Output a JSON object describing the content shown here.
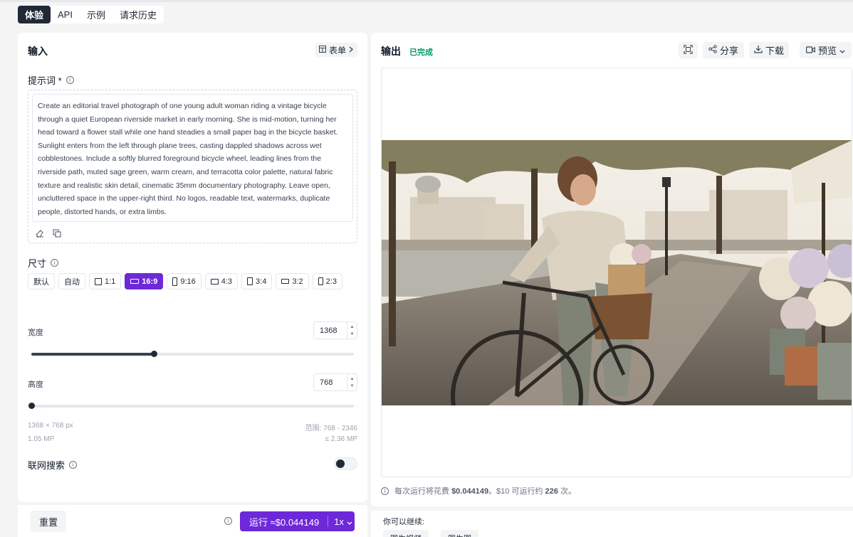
{
  "tabs": [
    {
      "label": "体验",
      "active": true
    },
    {
      "label": "API",
      "active": false
    },
    {
      "label": "示例",
      "active": false
    },
    {
      "label": "请求历史",
      "active": false
    }
  ],
  "input": {
    "title": "输入",
    "form_button": "表单",
    "prompt_label": "提示词 *",
    "prompt_text": "Create an editorial travel photograph of one young adult woman riding a vintage bicycle through a quiet European riverside market in early morning. She is mid-motion, turning her head toward a flower stall while one hand steadies a small paper bag in the bicycle basket. Sunlight enters from the left through plane trees, casting dappled shadows across wet cobblestones. Include a softly blurred foreground bicycle wheel, leading lines from the riverside path, muted sage green, warm cream, and terracotta color palette, natural fabric texture and realistic skin detail, cinematic 35mm documentary photography. Leave open, uncluttered space in the upper-right third. No logos, readable text, watermarks, duplicate people, distorted hands, or extra limbs.",
    "size_label": "尺寸",
    "ratios": [
      {
        "label": "默认",
        "shape": "none",
        "active": false
      },
      {
        "label": "自动",
        "shape": "none",
        "active": false
      },
      {
        "label": "1:1",
        "shape": "square",
        "active": false
      },
      {
        "label": "16:9",
        "shape": "wide",
        "active": true
      },
      {
        "label": "9:16",
        "shape": "tall",
        "active": false
      },
      {
        "label": "4:3",
        "shape": "landscape",
        "active": false
      },
      {
        "label": "3:4",
        "shape": "portrait",
        "active": false
      },
      {
        "label": "3:2",
        "shape": "landscape",
        "active": false
      },
      {
        "label": "2:3",
        "shape": "portrait",
        "active": false
      }
    ],
    "width_label": "宽度",
    "width_value": "1368",
    "width_slider_fraction": 0.38,
    "height_label": "高度",
    "height_value": "768",
    "height_slider_fraction": 0.0,
    "dims_text": "1368 × 768 px",
    "range_text": "范围: 768 - 2346",
    "mp_text": "1.05 MP",
    "max_mp_text": "≤ 2.36 MP",
    "web_search_label": "联网搜索",
    "web_search_enabled": false
  },
  "footer": {
    "reset_label": "重置",
    "run_label": "运行 ≈$0.044149",
    "multiplier_label": "1x"
  },
  "output": {
    "title": "输出",
    "status": "已完成",
    "share_label": "分享",
    "download_label": "下载",
    "preview_label": "预览",
    "cost_text_prefix": "每次运行将花费",
    "cost_value": "$0.044149",
    "cost_text_mid": "。$10 可运行约",
    "runs_value": "226",
    "cost_text_suffix": "次。",
    "continue_label": "你可以继续:",
    "continue_chips": [
      "图生视频",
      "图生图"
    ]
  },
  "colors": {
    "accent": "#6d28d9",
    "success": "#059669",
    "dark": "#1f2937"
  }
}
